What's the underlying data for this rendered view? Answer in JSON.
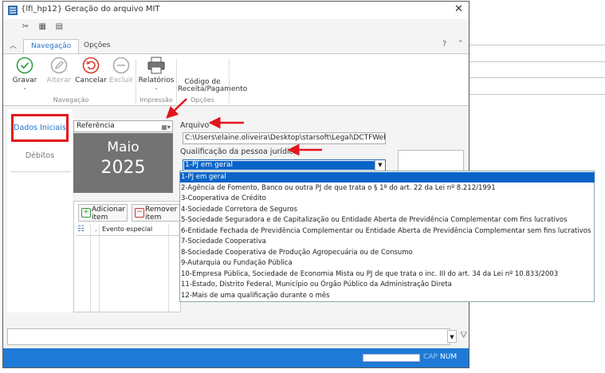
{
  "window": {
    "title": "{lfi_hp12} Geração do arquivo MIT",
    "close_glyph": "✕"
  },
  "ribbon": {
    "tabs": [
      {
        "label": "Navegação"
      },
      {
        "label": "Opções"
      }
    ],
    "help_glyph": "?",
    "buttons": {
      "gravar": "Gravar",
      "alterar": "Alterar",
      "cancelar": "Cancelar",
      "excluir": "Excluir",
      "relatorios": "Relatórios",
      "codigo": "Código de Receita/Pagamento"
    },
    "groups": {
      "navegacao": "Navegação",
      "impressao": "Impressão",
      "opcoes": "Opções"
    },
    "accent_color": "#1e74c8"
  },
  "sidebar": {
    "items": [
      {
        "label": "Dados Iniciais"
      },
      {
        "label": "Débitos"
      }
    ],
    "highlight_color": "#e3161f"
  },
  "referencia": {
    "label": "Referência",
    "month": "Maio",
    "year": "2025"
  },
  "events": {
    "add_label": "Adicionar item",
    "remove_label": "Remover item",
    "column_dot": ".",
    "column_label": "Evento especial"
  },
  "form": {
    "arquivo_label": "Arquivo",
    "arquivo_value": "C:\\Users\\elaine.oliveira\\Desktop\\starsoft\\Legal\\DCTFWeb\\MI",
    "qualificacao_label": "Qualificação da pessoa jurídica",
    "qualificacao_selected": "1-PJ em geral"
  },
  "qualificacao_options": [
    "1-PJ em geral",
    "2-Agência de Fomento, Banco ou outra PJ de que trata o § 1º do art. 22 da Lei nº 8.212/1991",
    "3-Cooperativa de Crédito",
    "4-Sociedade Corretora de Seguros",
    "5-Sociedade Seguradora e de Capitalização ou Entidade Aberta de Previdência Complementar com fins lucrativos",
    "6-Entidade Fechada de Previdência Complementar ou Entidade Aberta de Previdência Complementar sem fins lucrativos",
    "7-Sociedade Cooperativa",
    "8-Sociedade Cooperativa de Produção Agropecuária ou de Consumo",
    "9-Autarquia ou Fundação Pública",
    "10-Empresa Pública, Sociedade de Economia Mista ou PJ de que trata o inc. III do art. 34 da Lei nº 10.833/2003",
    "11-Estado, Distrito Federal, Município ou Órgão Público da Administração Direta",
    "12-Mais de uma qualificação durante o mês"
  ],
  "statusbar": {
    "cap": "CAP",
    "num": "NUM",
    "color": "#1e7ad6"
  }
}
